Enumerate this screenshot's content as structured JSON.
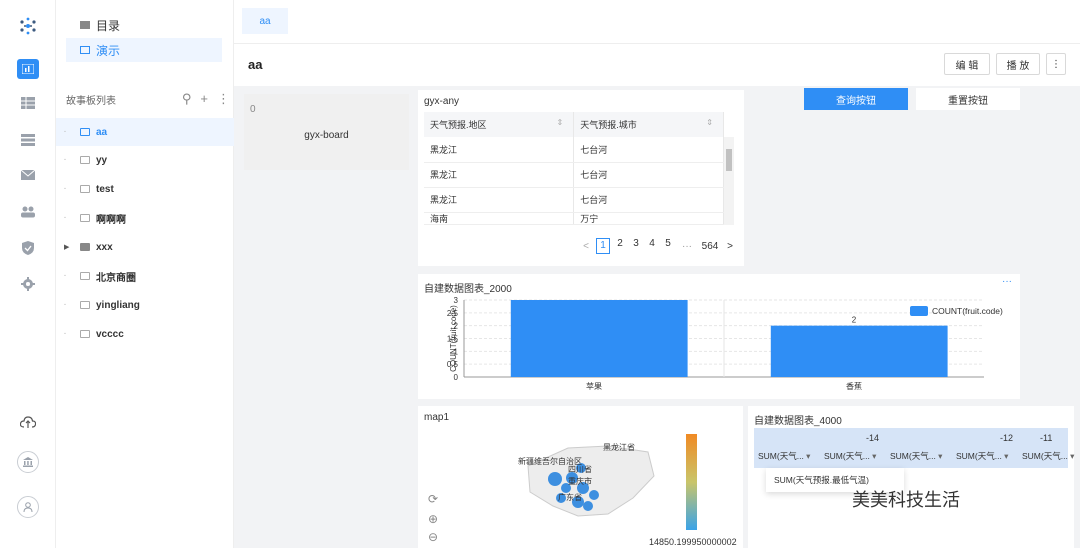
{
  "sidebar": {
    "catalog": "目录",
    "demo": "演示",
    "list_title": "故事板列表",
    "stories": [
      {
        "label": "aa",
        "type": "story"
      },
      {
        "label": "yy",
        "type": "story"
      },
      {
        "label": "test",
        "type": "story"
      },
      {
        "label": "啊啊啊",
        "type": "story"
      },
      {
        "label": "xxx",
        "type": "folder"
      },
      {
        "label": "北京商圈",
        "type": "story"
      },
      {
        "label": "yingliang",
        "type": "story"
      },
      {
        "label": "vcccc",
        "type": "story"
      }
    ]
  },
  "tabs": {
    "active": "aa"
  },
  "header": {
    "title": "aa",
    "edit": "编 辑",
    "play": "播 放",
    "more": "⋮"
  },
  "board": {
    "index": "0",
    "name": "gyx-board"
  },
  "table_card": {
    "title": "gyx-any",
    "columns": [
      "天气预报.地区",
      "天气预报.城市"
    ],
    "rows": [
      [
        "黑龙江",
        "七台河"
      ],
      [
        "黑龙江",
        "七台河"
      ],
      [
        "黑龙江",
        "七台河"
      ],
      [
        "海南",
        "万宁"
      ]
    ],
    "pager": {
      "prev": "<",
      "pages": [
        "1",
        "2",
        "3",
        "4",
        "5"
      ],
      "ellipsis": "···",
      "last": "564",
      "next": ">"
    }
  },
  "query": {
    "search": "查询按钮",
    "reset": "重置按钮"
  },
  "chart_card": {
    "title": "自建数据图表_2000",
    "more": "···"
  },
  "chart_data": {
    "type": "bar",
    "categories": [
      "苹果",
      "香蕉"
    ],
    "series": [
      {
        "name": "COUNT(fruit.code)",
        "values": [
          3,
          2
        ]
      }
    ],
    "ylabel": "COUNT(fruit.code)",
    "ylim": [
      0,
      3
    ],
    "yticks": [
      "0",
      "0.5",
      "1",
      "1.5",
      "2",
      "2.5",
      "3"
    ],
    "data_labels": [
      "2"
    ],
    "color": "#2f8ef5",
    "grid": true,
    "legend": "top-right"
  },
  "map_card": {
    "title": "map1",
    "gradient_label": "14850.199950000002",
    "regions": [
      "黑龙江省",
      "新疆维吾尔自治区",
      "四川省",
      "重庆市",
      "广东省"
    ]
  },
  "cross_card": {
    "title": "自建数据图表_4000",
    "numbers": [
      "-14",
      "-12",
      "-11"
    ],
    "columns": [
      "SUM(天气...",
      "SUM(天气...",
      "SUM(天气...",
      "SUM(天气...",
      "SUM(天气..."
    ],
    "popup": "SUM(天气预报.最低气温)"
  },
  "watermark": "美美科技生活",
  "colors": {
    "accent": "#2f8ef5",
    "canvas": "#f2f3f5"
  }
}
